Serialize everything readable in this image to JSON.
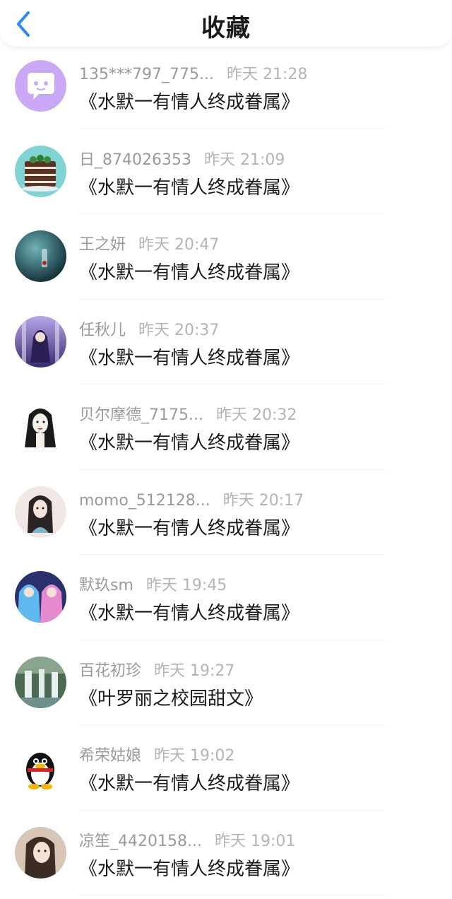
{
  "header": {
    "title": "收藏",
    "back_icon": "chevron-left-icon",
    "accent": "#2f8af5"
  },
  "items": [
    {
      "name": "135***797_775...",
      "time": "昨天 21:28",
      "book": "《水默一有情人终成眷属》",
      "avatar": "chat-bubble-icon"
    },
    {
      "name": "日_874026353",
      "time": "昨天 21:09",
      "book": "《水默一有情人终成眷属》",
      "avatar": "cake-photo"
    },
    {
      "name": "王之妍",
      "time": "昨天 20:47",
      "book": "《水默一有情人终成眷属》",
      "avatar": "dark-teal-photo"
    },
    {
      "name": "任秋儿",
      "time": "昨天 20:37",
      "book": "《水默一有情人终成眷属》",
      "avatar": "anime-purple-photo"
    },
    {
      "name": "贝尔摩德_7175...",
      "time": "昨天 20:32",
      "book": "《水默一有情人终成眷属》",
      "avatar": "sketch-girl-photo"
    },
    {
      "name": "momo_512128...",
      "time": "昨天 20:17",
      "book": "《水默一有情人终成眷属》",
      "avatar": "girl-illustration-photo"
    },
    {
      "name": "默玖sm",
      "time": "昨天 19:45",
      "book": "《水默一有情人终成眷属》",
      "avatar": "anime-duo-photo"
    },
    {
      "name": "百花初珍",
      "time": "昨天 19:27",
      "book": "《叶罗丽之校园甜文》",
      "avatar": "waterfall-photo"
    },
    {
      "name": "希荣姑娘",
      "time": "昨天 19:02",
      "book": "《水默一有情人终成眷属》",
      "avatar": "penguin-icon"
    },
    {
      "name": "凉笙_4420158...",
      "time": "昨天 19:01",
      "book": "《水默一有情人终成眷属》",
      "avatar": "selfie-photo"
    }
  ]
}
